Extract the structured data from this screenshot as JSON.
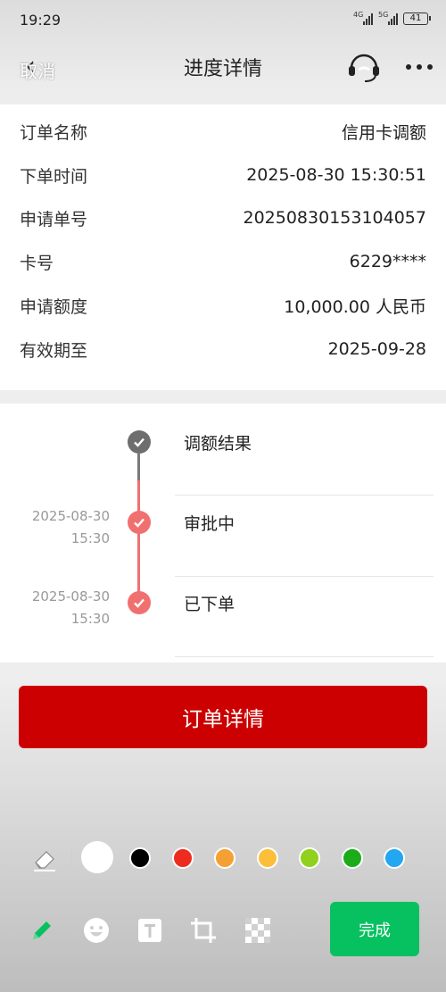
{
  "status_bar": {
    "time": "19:29",
    "signal1": "4G",
    "signal2": "5G",
    "battery": "41"
  },
  "nav": {
    "back_label": "取消",
    "title": "进度详情",
    "icons": [
      "headset-icon",
      "more-icon"
    ]
  },
  "order_info": {
    "rows": [
      {
        "label": "订单名称",
        "value": "信用卡调额"
      },
      {
        "label": "下单时间",
        "value": "2025-08-30 15:30:51"
      },
      {
        "label": "申请单号",
        "value": "20250830153104057"
      },
      {
        "label": "卡号",
        "value": "6229****"
      },
      {
        "label": "申请额度",
        "value": "10,000.00 人民币"
      },
      {
        "label": "有效期至",
        "value": "2025-09-28"
      }
    ]
  },
  "timeline": {
    "steps": [
      {
        "title": "调额结果",
        "date": "",
        "time": "",
        "color": "#6e6e6e"
      },
      {
        "title": "审批中",
        "date": "2025-08-30",
        "time": "15:30",
        "color": "#f07070"
      },
      {
        "title": "已下单",
        "date": "2025-08-30",
        "time": "15:30",
        "color": "#f07070"
      }
    ]
  },
  "detail_button": {
    "label": "订单详情",
    "color": "#cc0000"
  },
  "editor": {
    "colors": [
      "#ffffff",
      "#000000",
      "#ee2b1f",
      "#f5a033",
      "#fcbf3a",
      "#8fd11c",
      "#1aad19",
      "#22a7f0"
    ],
    "selected_color": "#ffffff",
    "tools": [
      "pencil-icon",
      "emoji-icon",
      "text-icon",
      "crop-icon",
      "mosaic-icon"
    ],
    "done_label": "完成",
    "done_color": "#07c160"
  }
}
